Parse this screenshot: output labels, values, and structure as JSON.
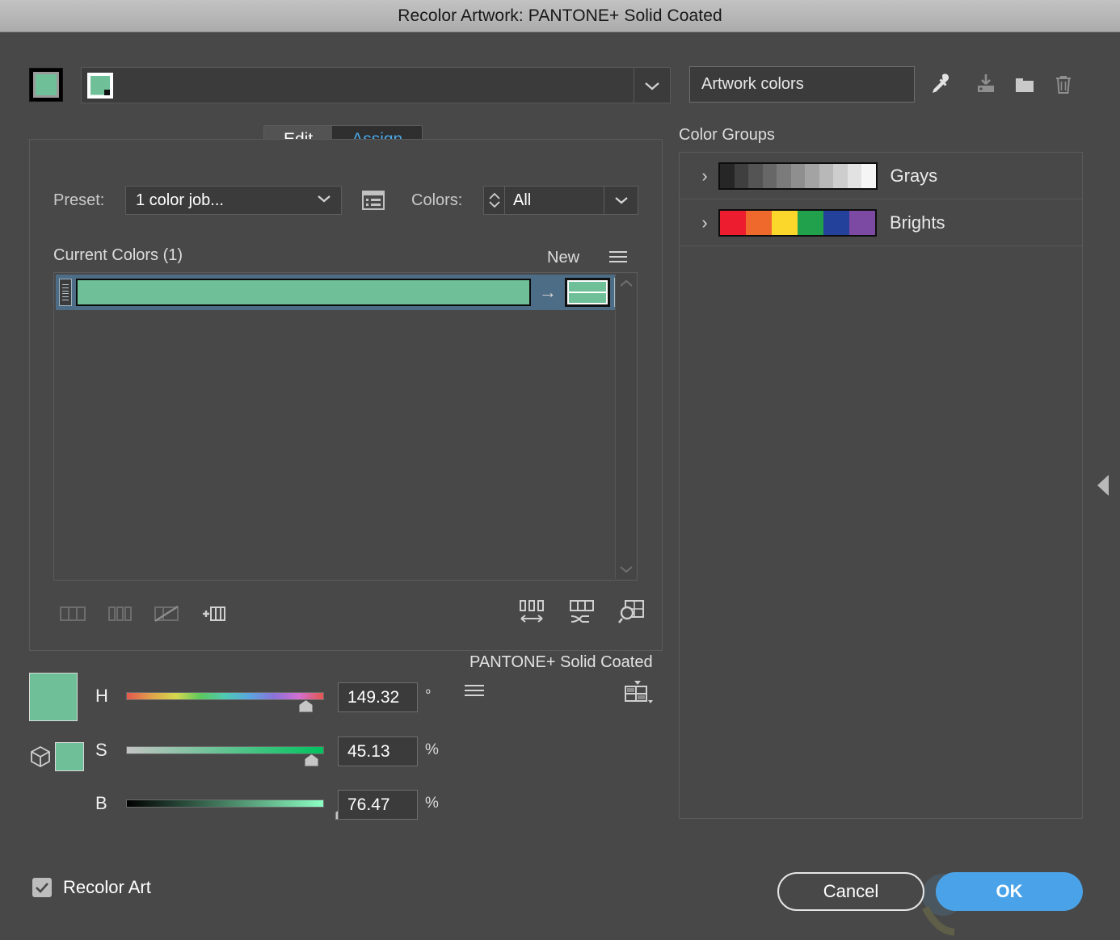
{
  "window": {
    "title": "Recolor Artwork: PANTONE+ Solid Coated"
  },
  "toolbar": {
    "artwork_colors_value": "Artwork colors",
    "artwork_colors_placeholder": "Artwork colors",
    "color_swatch_hex": "#6FC098",
    "group_swatch_hex": "#6FC098",
    "icons": {
      "eyedropper": "eyedropper-icon",
      "save": "save-color-group-icon",
      "folder": "new-color-group-icon",
      "trash": "delete-color-group-icon"
    }
  },
  "tabs": [
    {
      "label": "Edit",
      "active": false
    },
    {
      "label": "Assign",
      "active": true
    }
  ],
  "options": {
    "preset_label": "Preset:",
    "preset_value": "1 color job...",
    "colors_label": "Colors:",
    "colors_value": "All"
  },
  "current_colors": {
    "header": "Current Colors (1)",
    "new_header": "New",
    "rows": [
      {
        "current_hex": "#6FC098",
        "new_hex": "#6FC098",
        "selected": true
      }
    ]
  },
  "sliders": {
    "model_label": "PANTONE+ Solid Coated",
    "preview_hex": "#6FC098",
    "items": [
      {
        "letter": "H",
        "value": "149.32",
        "unit": "°"
      },
      {
        "letter": "S",
        "value": "45.13",
        "unit": "%"
      },
      {
        "letter": "B",
        "value": "76.47",
        "unit": "%"
      }
    ]
  },
  "color_groups": {
    "title": "Color Groups",
    "items": [
      {
        "name": "Grays",
        "swatches": [
          "#262626",
          "#3f3f3f",
          "#545454",
          "#676767",
          "#7b7b7b",
          "#8f8f8f",
          "#a3a3a3",
          "#b8b8b8",
          "#cdcdcd",
          "#e2e2e2",
          "#f5f5f5"
        ]
      },
      {
        "name": "Brights",
        "swatches": [
          "#ED1C2E",
          "#F0692C",
          "#FBD72B",
          "#21A14B",
          "#23409A",
          "#7C49A3"
        ]
      }
    ]
  },
  "footer": {
    "recolor_art_label": "Recolor Art",
    "recolor_art_checked": true,
    "cancel_label": "Cancel",
    "ok_label": "OK",
    "accent_hex": "#4AA3E8"
  }
}
